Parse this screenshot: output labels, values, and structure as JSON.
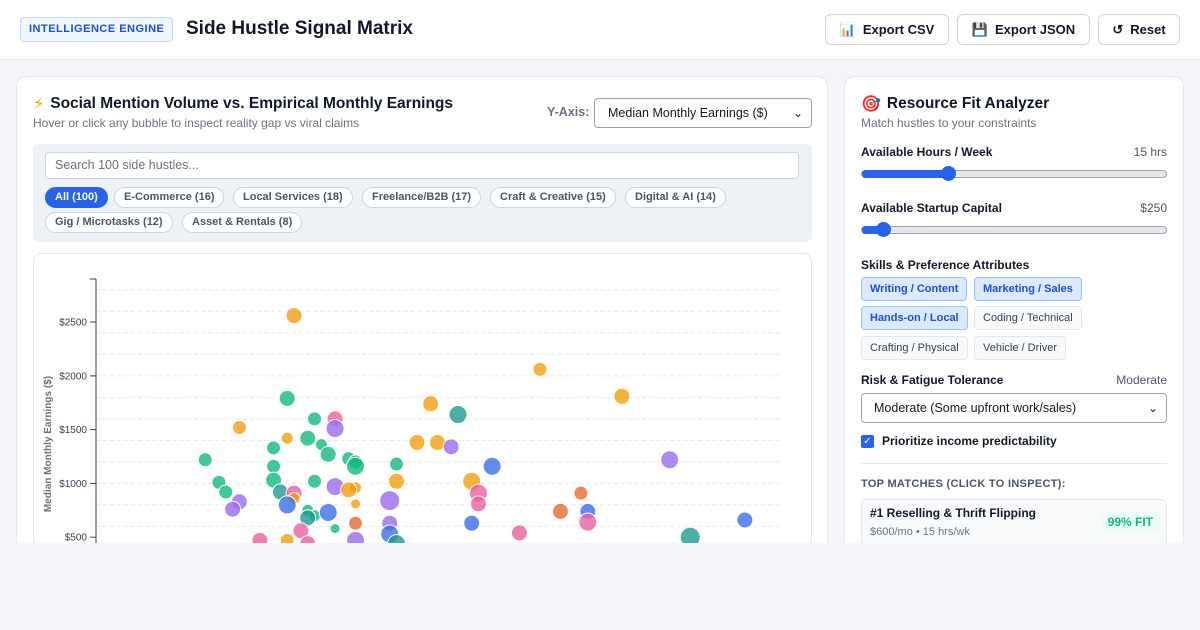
{
  "header": {
    "badge": "INTELLIGENCE ENGINE",
    "title": "Side Hustle Signal Matrix",
    "buttons": [
      {
        "label": "Export CSV",
        "icon": "bar-chart-icon"
      },
      {
        "label": "Export JSON",
        "icon": "floppy-disk-icon"
      },
      {
        "label": "Reset",
        "icon": "reset-icon"
      }
    ]
  },
  "left_panel": {
    "title": "Social Mention Volume vs. Empirical Monthly Earnings",
    "subtitle": "Hover or click any bubble to inspect reality gap vs viral claims",
    "y_axis_label": "Y-Axis:",
    "y_axis_selected": "Median Monthly Earnings ($)",
    "search_placeholder": "Search 100 side hustles...",
    "filters": [
      {
        "label": "All (100)",
        "active": true
      },
      {
        "label": "E-Commerce (16)",
        "active": false
      },
      {
        "label": "Local Services (18)",
        "active": false
      },
      {
        "label": "Freelance/B2B (17)",
        "active": false
      },
      {
        "label": "Craft & Creative (15)",
        "active": false
      },
      {
        "label": "Digital & AI (14)",
        "active": false
      },
      {
        "label": "Gig / Microtasks (12)",
        "active": false
      },
      {
        "label": "Asset & Rentals (8)",
        "active": false
      }
    ]
  },
  "chart_data": {
    "type": "scatter",
    "ylabel": "Median Monthly Earnings ($)",
    "y_ticks": [
      "$500",
      "$1000",
      "$1500",
      "$2000",
      "$2500"
    ],
    "ylim": [
      0,
      2900
    ],
    "xlim": [
      0,
      100
    ],
    "grid": true,
    "colors": {
      "green": "#10b981",
      "orange": "#f59e0b",
      "blue": "#3b6fe6",
      "purple": "#9b6cf0",
      "pink": "#ec5fa3",
      "teal": "#1f9a94",
      "red": "#ea6a2f"
    },
    "points": [
      {
        "x": 29,
        "y": 2560,
        "c": "orange",
        "r": 8
      },
      {
        "x": 65,
        "y": 2060,
        "c": "orange",
        "r": 7
      },
      {
        "x": 77,
        "y": 1810,
        "c": "orange",
        "r": 8
      },
      {
        "x": 28,
        "y": 1790,
        "c": "green",
        "r": 8
      },
      {
        "x": 49,
        "y": 1740,
        "c": "orange",
        "r": 8
      },
      {
        "x": 53,
        "y": 1640,
        "c": "teal",
        "r": 9
      },
      {
        "x": 32,
        "y": 1600,
        "c": "green",
        "r": 7
      },
      {
        "x": 35,
        "y": 1600,
        "c": "pink",
        "r": 8
      },
      {
        "x": 35,
        "y": 1510,
        "c": "purple",
        "r": 9
      },
      {
        "x": 21,
        "y": 1520,
        "c": "orange",
        "r": 7
      },
      {
        "x": 28,
        "y": 1420,
        "c": "orange",
        "r": 6
      },
      {
        "x": 31,
        "y": 1420,
        "c": "green",
        "r": 8
      },
      {
        "x": 33,
        "y": 1360,
        "c": "green",
        "r": 6
      },
      {
        "x": 26,
        "y": 1330,
        "c": "green",
        "r": 7
      },
      {
        "x": 47,
        "y": 1380,
        "c": "orange",
        "r": 8
      },
      {
        "x": 50,
        "y": 1380,
        "c": "orange",
        "r": 8
      },
      {
        "x": 52,
        "y": 1340,
        "c": "purple",
        "r": 8
      },
      {
        "x": 34,
        "y": 1270,
        "c": "green",
        "r": 8
      },
      {
        "x": 37,
        "y": 1230,
        "c": "green",
        "r": 7
      },
      {
        "x": 38,
        "y": 1200,
        "c": "green",
        "r": 7
      },
      {
        "x": 38,
        "y": 1160,
        "c": "green",
        "r": 9
      },
      {
        "x": 44,
        "y": 1180,
        "c": "green",
        "r": 7
      },
      {
        "x": 16,
        "y": 1220,
        "c": "green",
        "r": 7
      },
      {
        "x": 26,
        "y": 1160,
        "c": "green",
        "r": 7
      },
      {
        "x": 58,
        "y": 1160,
        "c": "blue",
        "r": 9
      },
      {
        "x": 84,
        "y": 1220,
        "c": "purple",
        "r": 9
      },
      {
        "x": 18,
        "y": 1010,
        "c": "green",
        "r": 7
      },
      {
        "x": 26,
        "y": 1030,
        "c": "green",
        "r": 8
      },
      {
        "x": 32,
        "y": 1020,
        "c": "green",
        "r": 7
      },
      {
        "x": 35,
        "y": 970,
        "c": "purple",
        "r": 9
      },
      {
        "x": 38,
        "y": 960,
        "c": "orange",
        "r": 6
      },
      {
        "x": 37,
        "y": 940,
        "c": "orange",
        "r": 8
      },
      {
        "x": 44,
        "y": 1020,
        "c": "orange",
        "r": 8
      },
      {
        "x": 55,
        "y": 1020,
        "c": "orange",
        "r": 9
      },
      {
        "x": 56,
        "y": 910,
        "c": "pink",
        "r": 9
      },
      {
        "x": 19,
        "y": 920,
        "c": "green",
        "r": 7
      },
      {
        "x": 27,
        "y": 920,
        "c": "teal",
        "r": 8
      },
      {
        "x": 29,
        "y": 910,
        "c": "pink",
        "r": 8
      },
      {
        "x": 29,
        "y": 860,
        "c": "orange",
        "r": 6
      },
      {
        "x": 38,
        "y": 810,
        "c": "orange",
        "r": 5
      },
      {
        "x": 43,
        "y": 840,
        "c": "purple",
        "r": 10
      },
      {
        "x": 21,
        "y": 830,
        "c": "purple",
        "r": 8
      },
      {
        "x": 20,
        "y": 760,
        "c": "purple",
        "r": 8
      },
      {
        "x": 28,
        "y": 800,
        "c": "blue",
        "r": 9
      },
      {
        "x": 31,
        "y": 750,
        "c": "green",
        "r": 6
      },
      {
        "x": 32,
        "y": 700,
        "c": "green",
        "r": 6
      },
      {
        "x": 34,
        "y": 730,
        "c": "blue",
        "r": 9
      },
      {
        "x": 31,
        "y": 680,
        "c": "teal",
        "r": 8
      },
      {
        "x": 56,
        "y": 810,
        "c": "pink",
        "r": 8
      },
      {
        "x": 71,
        "y": 910,
        "c": "red",
        "r": 7
      },
      {
        "x": 68,
        "y": 740,
        "c": "red",
        "r": 8
      },
      {
        "x": 72,
        "y": 740,
        "c": "blue",
        "r": 8
      },
      {
        "x": 38,
        "y": 630,
        "c": "red",
        "r": 7
      },
      {
        "x": 43,
        "y": 630,
        "c": "purple",
        "r": 8
      },
      {
        "x": 35,
        "y": 580,
        "c": "green",
        "r": 5
      },
      {
        "x": 30,
        "y": 560,
        "c": "pink",
        "r": 8
      },
      {
        "x": 55,
        "y": 630,
        "c": "blue",
        "r": 8
      },
      {
        "x": 62,
        "y": 540,
        "c": "pink",
        "r": 8
      },
      {
        "x": 72,
        "y": 640,
        "c": "pink",
        "r": 9
      },
      {
        "x": 24,
        "y": 470,
        "c": "pink",
        "r": 8
      },
      {
        "x": 28,
        "y": 470,
        "c": "orange",
        "r": 7
      },
      {
        "x": 43,
        "y": 530,
        "c": "blue",
        "r": 9
      },
      {
        "x": 38,
        "y": 470,
        "c": "purple",
        "r": 9
      },
      {
        "x": 44,
        "y": 440,
        "c": "teal",
        "r": 9
      },
      {
        "x": 31,
        "y": 440,
        "c": "pink",
        "r": 8
      },
      {
        "x": 87,
        "y": 500,
        "c": "teal",
        "r": 10
      },
      {
        "x": 95,
        "y": 660,
        "c": "blue",
        "r": 8
      }
    ]
  },
  "right_panel": {
    "title": "Resource Fit Analyzer",
    "subtitle": "Match hustles to your constraints",
    "hours": {
      "label": "Available Hours / Week",
      "value_text": "15 hrs",
      "fraction": 0.28
    },
    "capital": {
      "label": "Available Startup Capital",
      "value_text": "$250",
      "fraction": 0.07
    },
    "skills_label": "Skills & Preference Attributes",
    "skills": [
      {
        "label": "Writing / Content",
        "on": true
      },
      {
        "label": "Marketing / Sales",
        "on": true
      },
      {
        "label": "Hands-on / Local",
        "on": true
      },
      {
        "label": "Coding / Technical",
        "on": false
      },
      {
        "label": "Crafting / Physical",
        "on": false
      },
      {
        "label": "Vehicle / Driver",
        "on": false
      }
    ],
    "risk": {
      "label": "Risk & Fatigue Tolerance",
      "value_text": "Moderate",
      "selected": "Moderate (Some upfront work/sales)"
    },
    "predictability": {
      "label": "Prioritize income predictability",
      "checked": true
    },
    "matches_heading": "TOP MATCHES (CLICK TO INSPECT):",
    "matches": [
      {
        "title": "#1 Reselling & Thrift Flipping",
        "meta": "$600/mo • 15 hrs/wk",
        "fit": "99% FIT"
      }
    ]
  }
}
